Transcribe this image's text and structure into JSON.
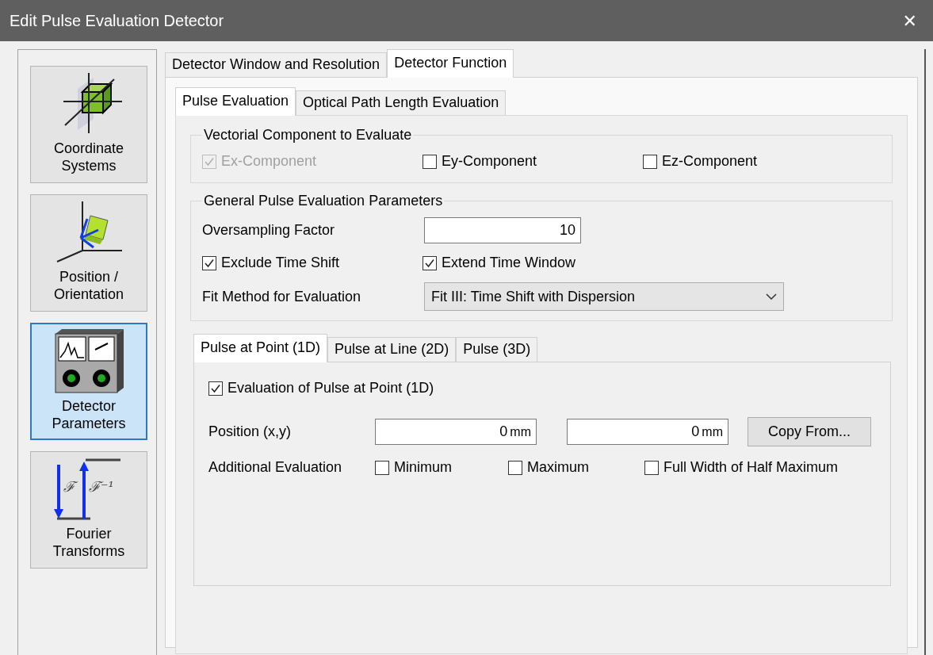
{
  "window": {
    "title": "Edit Pulse Evaluation Detector",
    "close": "✕"
  },
  "sidebar": {
    "items": [
      {
        "kind": "coordinates",
        "label": "Coordinate Systems",
        "selected": false
      },
      {
        "kind": "position",
        "label": "Position / Orientation",
        "selected": false
      },
      {
        "kind": "detector",
        "label": "Detector Parameters",
        "selected": true
      },
      {
        "kind": "fourier",
        "label": "Fourier Transforms",
        "selected": false,
        "glyphs": [
          "ℱ",
          "ℱ⁻¹"
        ]
      }
    ]
  },
  "tabs": [
    {
      "label": "Detector Window and Resolution",
      "selected": false
    },
    {
      "label": "Detector Function",
      "selected": true
    }
  ],
  "subtabs": [
    {
      "label": "Pulse Evaluation",
      "selected": true
    },
    {
      "label": "Optical Path Length Evaluation",
      "selected": false
    }
  ],
  "vectorial_group": {
    "title": "Vectorial Component to Evaluate",
    "checkboxes": [
      {
        "label": "Ex-Component",
        "checked": true,
        "disabled": true
      },
      {
        "label": "Ey-Component",
        "checked": false,
        "disabled": false
      },
      {
        "label": "Ez-Component",
        "checked": false,
        "disabled": false
      }
    ]
  },
  "general_group": {
    "title": "General Pulse Evaluation Parameters",
    "oversampling": {
      "label": "Oversampling Factor",
      "value": "10"
    },
    "checkboxes": [
      {
        "label": "Exclude Time Shift",
        "checked": true
      },
      {
        "label": "Extend Time Window",
        "checked": true
      }
    ],
    "fit_method": {
      "label": "Fit Method for Evaluation",
      "value": "Fit III: Time Shift with Dispersion"
    }
  },
  "point_tabs": [
    {
      "label": "Pulse at Point (1D)",
      "selected": true
    },
    {
      "label": "Pulse at Line (2D)",
      "selected": false
    },
    {
      "label": "Pulse (3D)",
      "selected": false
    }
  ],
  "point_panel": {
    "evaluation": {
      "label": "Evaluation of Pulse at Point (1D)",
      "checked": true
    },
    "position": {
      "label": "Position (x,y)",
      "fields": [
        {
          "value": "0",
          "unit": "mm"
        },
        {
          "value": "0",
          "unit": "mm"
        }
      ]
    },
    "copy_button": "Copy From...",
    "additional": {
      "label": "Additional Evaluation",
      "checkboxes": [
        {
          "label": "Minimum",
          "checked": false
        },
        {
          "label": "Maximum",
          "checked": false
        },
        {
          "label": "Full Width of Half Maximum",
          "checked": false
        }
      ]
    }
  }
}
